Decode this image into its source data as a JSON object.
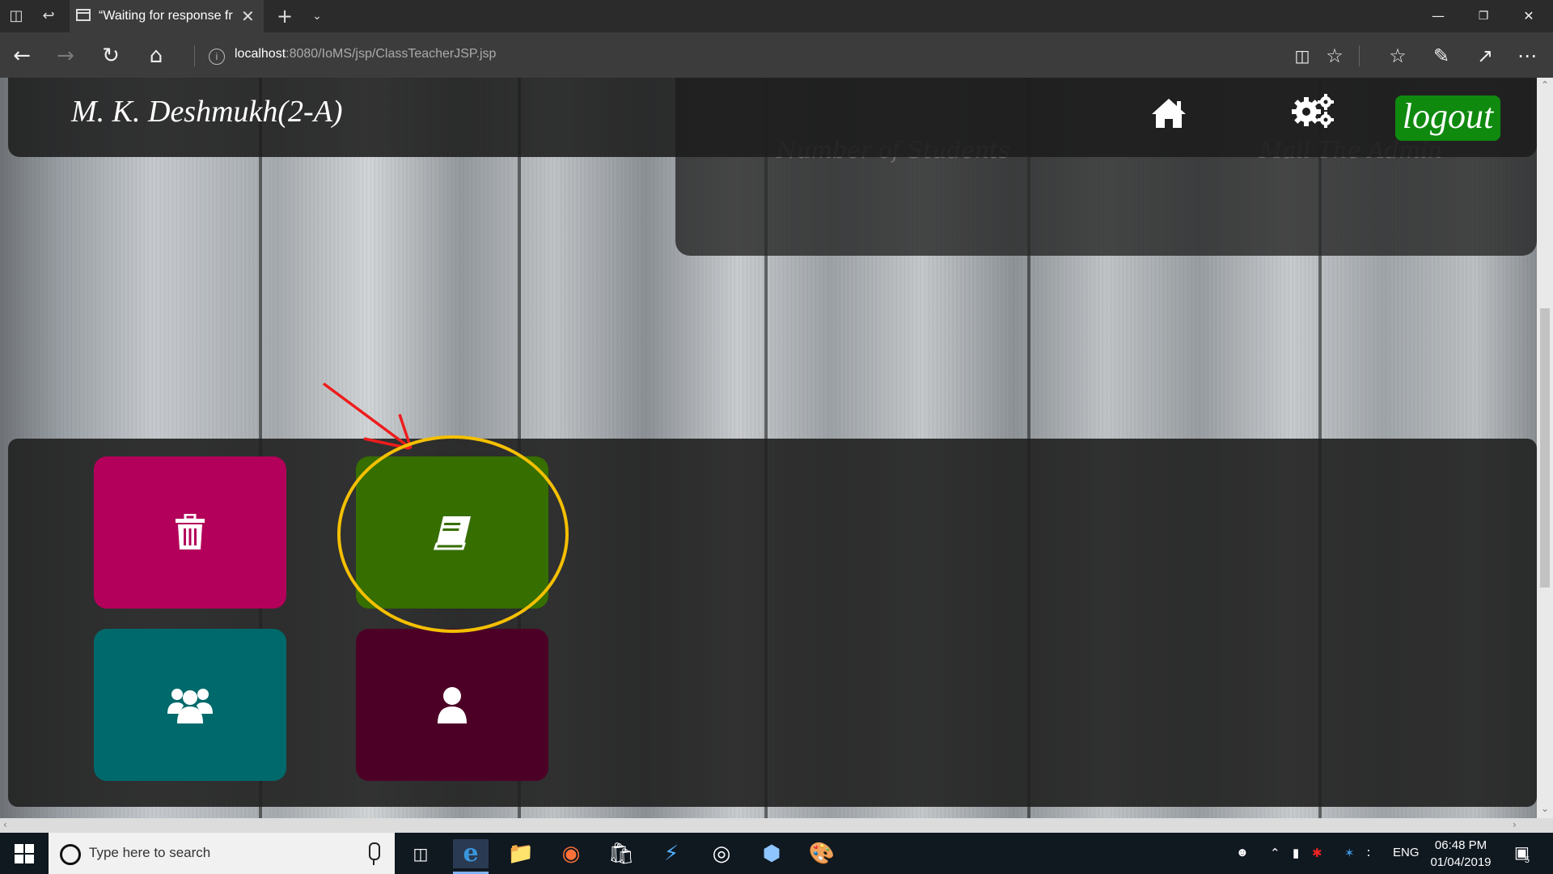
{
  "browser": {
    "tab_title": "“Waiting for response fr",
    "url_host": "localhost",
    "url_path": ":8080/IoMS/jsp/ClassTeacherJSP.jsp"
  },
  "header": {
    "teacher_name": "M. K. Deshmukh(2-A)",
    "logout_label": "logout",
    "home_icon": "home-icon",
    "settings_icon": "gears-icon"
  },
  "info_panel": {
    "students_label": "Number of Students",
    "mail_label": "Mail The Admin"
  },
  "tiles": [
    {
      "icon": "trash-icon",
      "color": "#b3005a"
    },
    {
      "icon": "book-icon",
      "color": "#366e00"
    },
    {
      "icon": "users-icon",
      "color": "#00696b"
    },
    {
      "icon": "user-icon",
      "color": "#4d0026"
    }
  ],
  "annotation": {
    "arrow_color": "#ee1c1c",
    "circle_color": "#f5c000"
  },
  "taskbar": {
    "search_placeholder": "Type here to search",
    "language": "ENG",
    "time": "06:48 PM",
    "date": "01/04/2019",
    "notification_count": "5"
  }
}
